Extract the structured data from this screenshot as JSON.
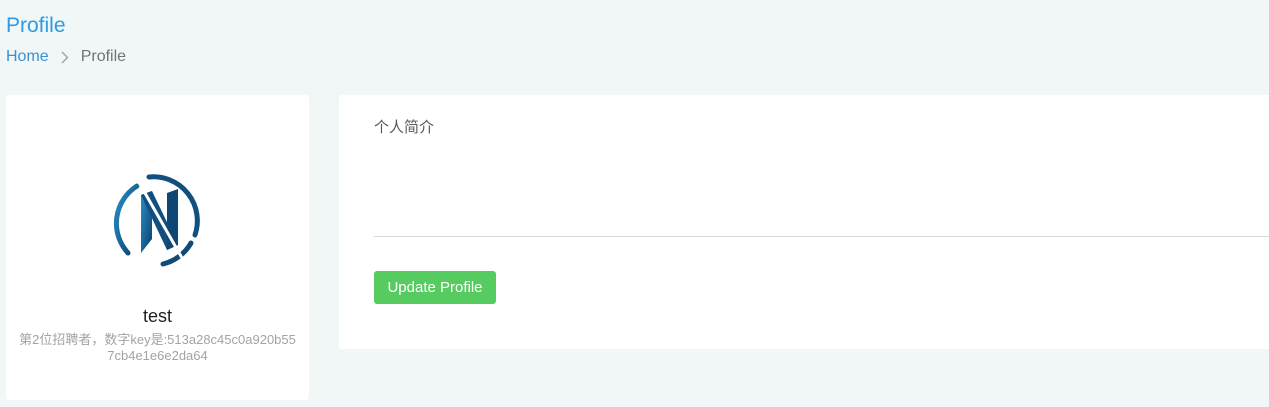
{
  "header": {
    "title": "Profile"
  },
  "breadcrumb": {
    "home": "Home",
    "current": "Profile",
    "separator_icon": "chevron-right-icon"
  },
  "profile_card": {
    "logo_icon": "n-circle-logo-icon",
    "username": "test",
    "bio": "第2位招聘者，数字key是:513a28c45c0a920b557cb4e1e6e2da64"
  },
  "form": {
    "bio_label": "个人简介",
    "bio_value": "",
    "submit_label": "Update Profile"
  },
  "colors": {
    "accent": "#2d9be2",
    "button": "#56cc60",
    "logo": "#0f4f7d",
    "background": "#f1f6f6"
  }
}
